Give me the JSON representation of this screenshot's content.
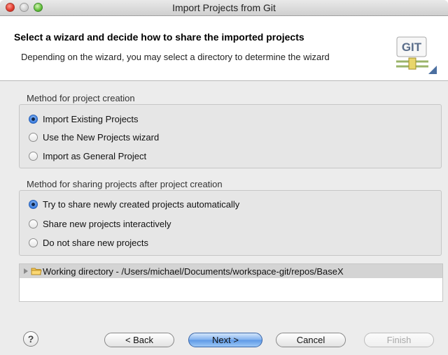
{
  "window": {
    "title": "Import Projects from Git"
  },
  "banner": {
    "title": "Select a wizard and decide how to share the imported projects",
    "description": "Depending on the wizard, you may select a directory to determine the wizard",
    "logo_text": "GIT"
  },
  "creation_group": {
    "label": "Method for project creation",
    "options": [
      {
        "label": "Import Existing Projects",
        "checked": true
      },
      {
        "label": "Use the New Projects wizard",
        "checked": false
      },
      {
        "label": "Import as General Project",
        "checked": false
      }
    ]
  },
  "sharing_group": {
    "label": "Method for sharing projects after project creation",
    "options": [
      {
        "label": "Try to share newly created projects automatically",
        "checked": true
      },
      {
        "label": "Share new projects interactively",
        "checked": false
      },
      {
        "label": "Do not share new projects",
        "checked": false
      }
    ]
  },
  "tree": {
    "item_label": "Working directory - /Users/michael/Documents/workspace-git/repos/BaseX",
    "icon": "folder-icon"
  },
  "footer": {
    "help_glyph": "?",
    "back_label": "< Back",
    "next_label": "Next >",
    "cancel_label": "Cancel",
    "finish_label": "Finish"
  }
}
